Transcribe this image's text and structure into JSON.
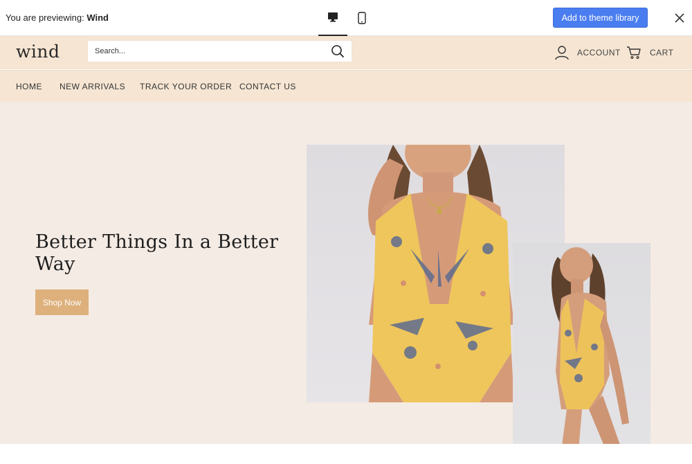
{
  "preview_bar": {
    "prefix": "You are previewing:",
    "theme_name": "Wind",
    "add_button": "Add to theme library",
    "devices": [
      "desktop-icon",
      "mobile-icon"
    ],
    "accent_color": "#4a7df0"
  },
  "header": {
    "logo": "wind",
    "search_placeholder": "Search...",
    "account_label": "ACCOUNT",
    "cart_label": "CART",
    "background_color": "#f5e5d2"
  },
  "nav": {
    "items": [
      {
        "label": "HOME"
      },
      {
        "label": "NEW ARRIVALS"
      },
      {
        "label": "TRACK YOUR ORDER"
      },
      {
        "label": "CONTACT US"
      }
    ]
  },
  "hero": {
    "title": "Better Things In a Better Way",
    "cta_label": "Shop Now",
    "cta_color": "#ddb07c",
    "background_color": "#f4ebe4"
  }
}
